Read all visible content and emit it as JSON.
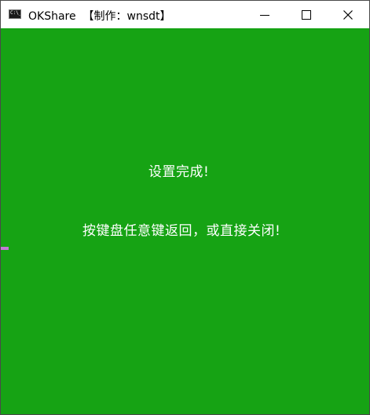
{
  "window": {
    "title": "OKShare  【制作：wnsdt】",
    "app_icon_text": "C:\\_",
    "controls": {
      "minimize": "minimize-icon",
      "maximize": "maximize-icon",
      "close": "close-icon"
    }
  },
  "console": {
    "background_color": "#16a314",
    "text_color": "#ffffff",
    "line1": "设置完成!",
    "line2": "按键盘任意键返回，或直接关闭!"
  }
}
